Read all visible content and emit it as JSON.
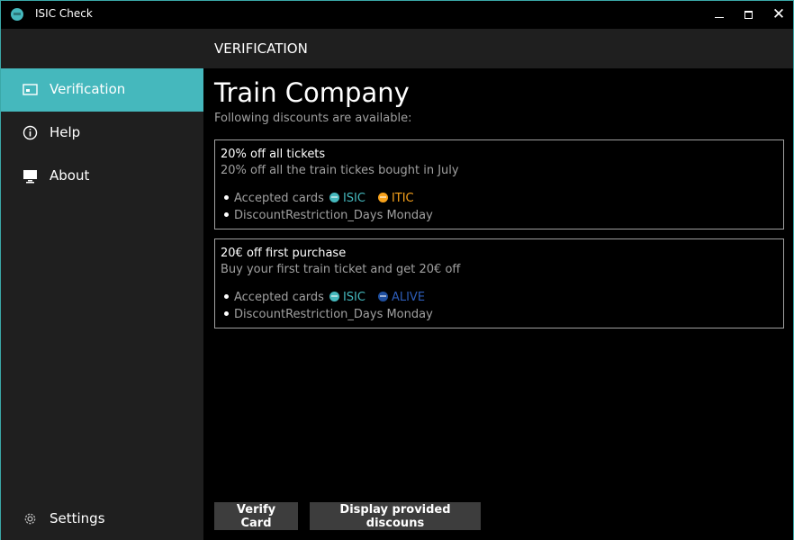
{
  "window": {
    "title": "ISIC Check"
  },
  "sidebar": {
    "items": [
      {
        "label": "Verification",
        "icon": "card-icon",
        "active": true
      },
      {
        "label": "Help",
        "icon": "info-icon"
      },
      {
        "label": "About",
        "icon": "monitor-icon"
      }
    ],
    "settings_label": "Settings"
  },
  "header": {
    "title": "VERIFICATION"
  },
  "main": {
    "company": "Train Company",
    "subtitle": "Following discounts are available:",
    "discounts": [
      {
        "title": "20% off all tickets",
        "description": "20% off all the train tickes bought in July",
        "accepted_label": "Accepted cards",
        "cards": [
          "ISIC",
          "ITIC"
        ],
        "restriction": "DiscountRestriction_Days Monday"
      },
      {
        "title": "20€ off first purchase",
        "description": "Buy your first train ticket and get 20€ off",
        "accepted_label": "Accepted cards",
        "cards": [
          "ISIC",
          "ALIVE"
        ],
        "restriction": "DiscountRestriction_Days Monday"
      }
    ]
  },
  "buttons": {
    "verify": "Verify Card",
    "display": "Display provided discouns"
  },
  "colors": {
    "accent": "#45b8bd",
    "itic": "#f7a21b",
    "alive": "#2d5cb8",
    "sidebar_bg": "#1f1f1f",
    "content_bg": "#000000"
  }
}
